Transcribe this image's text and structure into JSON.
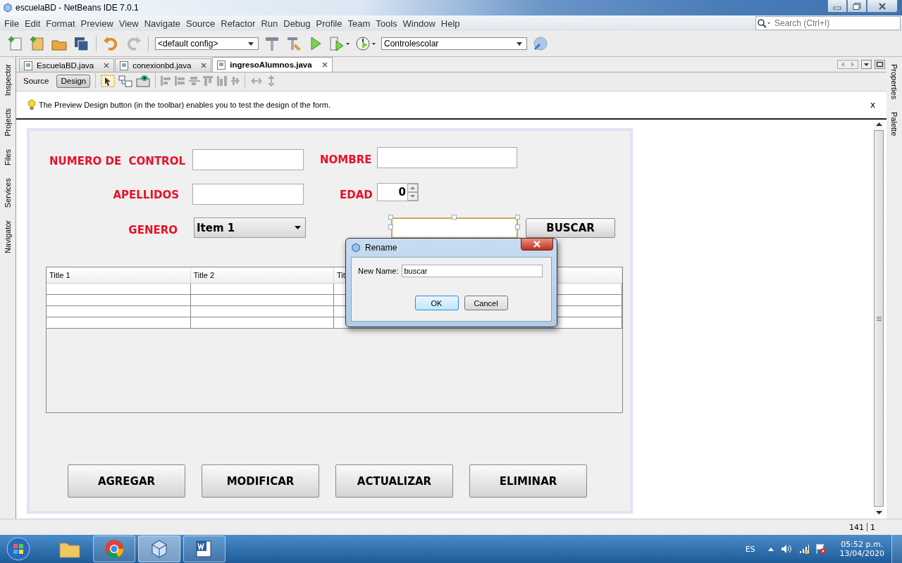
{
  "window": {
    "title": "escuelaBD - NetBeans IDE 7.0.1"
  },
  "menu": [
    "File",
    "Edit",
    "Format",
    "Preview",
    "View",
    "Navigate",
    "Source",
    "Refactor",
    "Run",
    "Debug",
    "Profile",
    "Team",
    "Tools",
    "Window",
    "Help"
  ],
  "search": {
    "placeholder": "Search (Ctrl+I)"
  },
  "toolbar": {
    "config": "<default config>",
    "project": "Controlescolar"
  },
  "tabs": [
    {
      "label": "EscuelaBD.java",
      "selected": false
    },
    {
      "label": "conexionbd.java",
      "selected": false
    },
    {
      "label": "ingresoAlumnos.java",
      "selected": true
    }
  ],
  "views": [
    {
      "label": "Source",
      "selected": false
    },
    {
      "label": "Design",
      "selected": true
    }
  ],
  "hint": {
    "text": "The Preview Design button (in the toolbar) enables you to test the design of the form.",
    "close": "x"
  },
  "left_panels": [
    "Inspector",
    "Projects",
    "Files",
    "Services",
    "Navigator"
  ],
  "right_panels": [
    "Properties",
    "Palette"
  ],
  "form": {
    "labels": [
      "NUMERO DE  CONTROL",
      "NOMBRE",
      "APELLIDOS",
      "EDAD",
      "GENERO"
    ],
    "edad_value": "0",
    "genero_value": "Item 1",
    "search_button": "BUSCAR",
    "table_columns": [
      "Title 1",
      "Title 2",
      "Tit"
    ],
    "buttons": [
      "AGREGAR",
      "MODIFICAR",
      "ACTUALIZAR",
      "ELIMINAR"
    ]
  },
  "dialog": {
    "title": "Rename",
    "field_label": "New Name:",
    "value": "buscar",
    "buttons": [
      {
        "label": "OK",
        "selected": true
      },
      {
        "label": "Cancel",
        "selected": false
      }
    ]
  },
  "status_bar": [
    "141",
    "1"
  ],
  "taskbar": {
    "language": "ES",
    "time": "05:52 p.m.",
    "date": "13/04/2020"
  }
}
